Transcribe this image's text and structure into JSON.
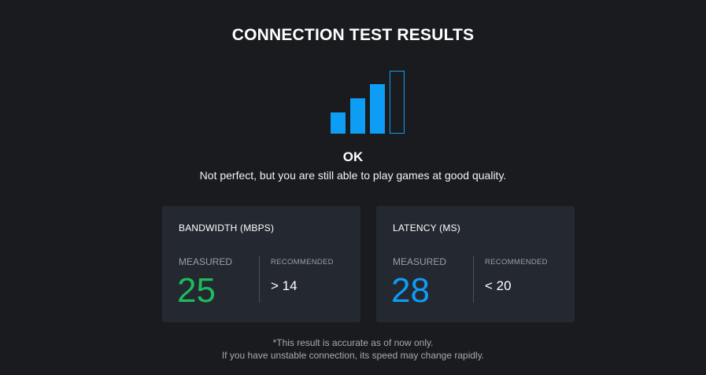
{
  "header": {
    "title": "CONNECTION TEST RESULTS"
  },
  "signal": {
    "icon": "signal-strength-icon",
    "strength_bars_filled": 3,
    "strength_bars_total": 4,
    "color": "#0d9df5"
  },
  "status": {
    "label": "OK",
    "description": "Not perfect, but you are still able to play games at good quality."
  },
  "bandwidth": {
    "title": "BANDWIDTH (MBPS)",
    "measured_label": "MEASURED",
    "measured_value": "25",
    "measured_color": "#1bbd5b",
    "recommended_label": "RECOMMENDED",
    "recommended_value": "> 14"
  },
  "latency": {
    "title": "LATENCY (MS)",
    "measured_label": "MEASURED",
    "measured_value": "28",
    "measured_color": "#0d9df5",
    "recommended_label": "RECOMMENDED",
    "recommended_value": "< 20"
  },
  "footnote": {
    "line1": "*This result is accurate as of now only.",
    "line2": "If you have unstable connection, its speed may change rapidly."
  }
}
